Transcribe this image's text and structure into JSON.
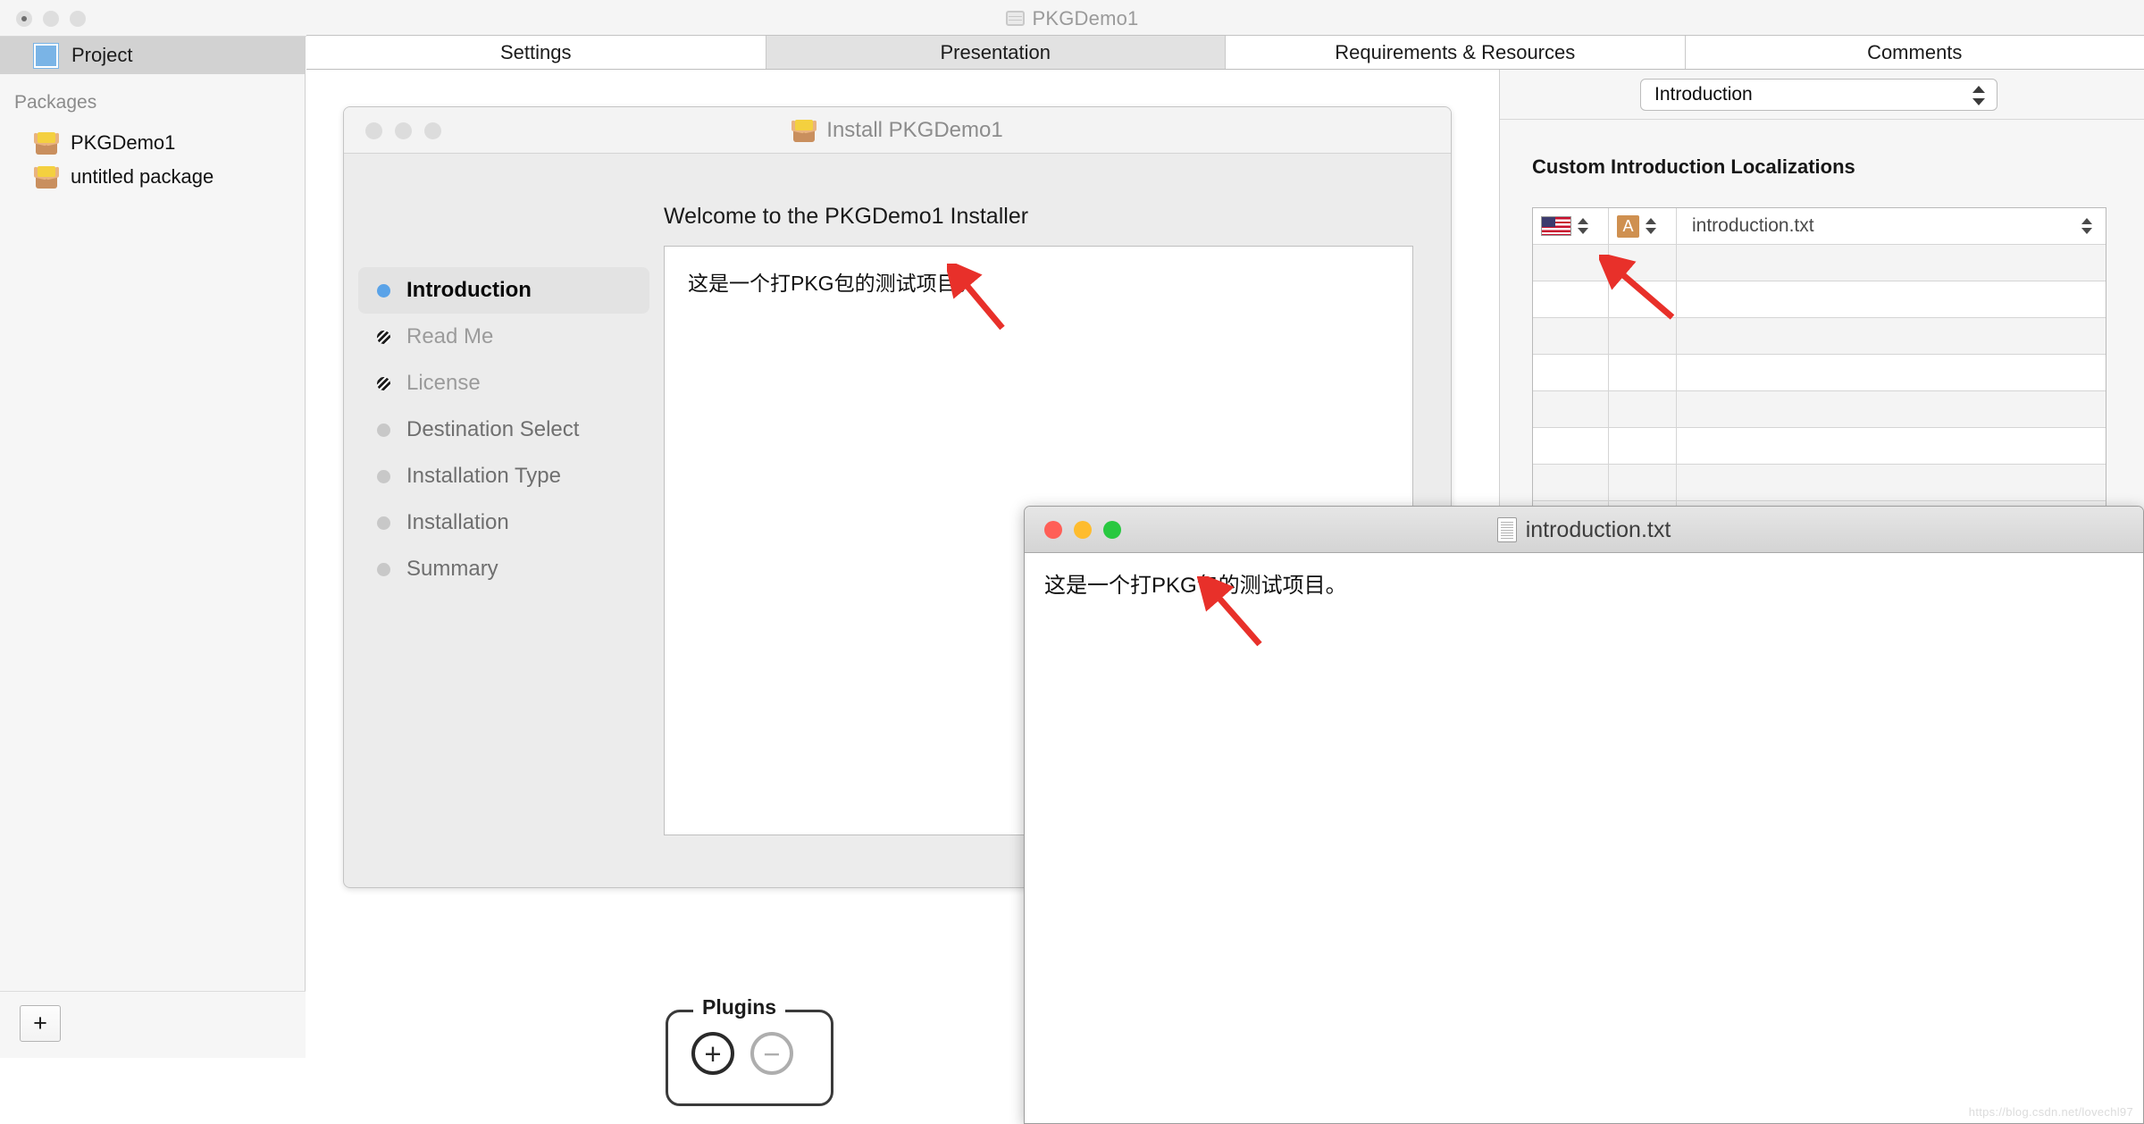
{
  "window": {
    "title": "PKGDemo1",
    "title_icon": "project-window-icon"
  },
  "sidebar": {
    "project_label": "Project",
    "section_header": "Packages",
    "packages": [
      {
        "label": "PKGDemo1",
        "icon": "package-box-icon"
      },
      {
        "label": "untitled package",
        "icon": "package-box-icon"
      }
    ],
    "add_button_label": "+"
  },
  "tabs": [
    {
      "label": "Settings",
      "selected": true
    },
    {
      "label": "Presentation",
      "selected": false
    },
    {
      "label": "Requirements & Resources",
      "selected": false
    },
    {
      "label": "Comments",
      "selected": false
    }
  ],
  "installer_preview": {
    "title": "Install PKGDemo1",
    "title_icon": "package-box-icon",
    "steps": [
      {
        "label": "Introduction",
        "state": "current"
      },
      {
        "label": "Read Me",
        "state": "disabled"
      },
      {
        "label": "License",
        "state": "disabled"
      },
      {
        "label": "Destination Select",
        "state": "upcoming"
      },
      {
        "label": "Installation Type",
        "state": "upcoming"
      },
      {
        "label": "Installation",
        "state": "upcoming"
      },
      {
        "label": "Summary",
        "state": "upcoming"
      }
    ],
    "welcome_heading": "Welcome to the PKGDemo1 Installer",
    "body_text": "这是一个打PKG包的测试项目。"
  },
  "plugins": {
    "caption": "Plugins",
    "add_label": "+",
    "remove_label": "−"
  },
  "right_panel": {
    "popup_value": "Introduction",
    "section_title": "Custom Introduction Localizations",
    "table": {
      "rows": [
        {
          "flag": "us-flag-icon",
          "type": "A",
          "file": "introduction.txt"
        },
        {
          "flag": "",
          "type": "",
          "file": ""
        },
        {
          "flag": "",
          "type": "",
          "file": ""
        },
        {
          "flag": "",
          "type": "",
          "file": ""
        },
        {
          "flag": "",
          "type": "",
          "file": ""
        },
        {
          "flag": "",
          "type": "",
          "file": ""
        },
        {
          "flag": "",
          "type": "",
          "file": ""
        },
        {
          "flag": "",
          "type": "",
          "file": ""
        },
        {
          "flag": "",
          "type": "",
          "file": ""
        },
        {
          "flag": "",
          "type": "",
          "file": ""
        }
      ]
    }
  },
  "text_window": {
    "title": "introduction.txt",
    "title_icon": "text-document-icon",
    "content": "这是一个打PKG包的测试项目。"
  },
  "watermark": "https://blog.csdn.net/lovechl97",
  "colors": {
    "accent_blue": "#5aa3e8",
    "package_orange": "#cf9050",
    "arrow_red": "#e8302a"
  }
}
